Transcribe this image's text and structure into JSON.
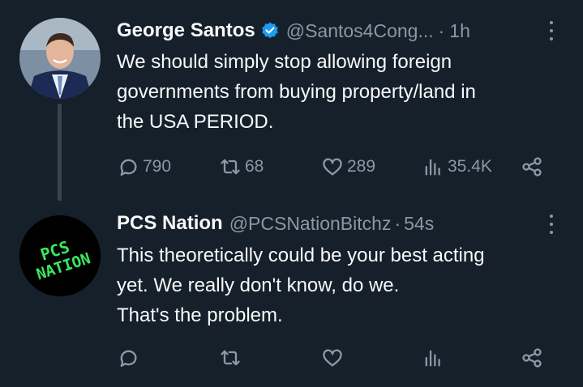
{
  "tweets": [
    {
      "name": "George Santos",
      "verified": true,
      "handle": "@Santos4Cong...",
      "time": "1h",
      "text": [
        "We should simply stop allowing foreign",
        "governments from buying property/land in",
        "the USA PERIOD."
      ],
      "replies": "790",
      "retweets": "68",
      "likes": "289",
      "views": "35.4K"
    },
    {
      "name": "PCS Nation",
      "handle": "@PCSNationBitchz",
      "time": "54s",
      "avatar_text": [
        "PCS",
        "NATION"
      ],
      "text": [
        "This theoretically could be your best acting",
        "yet. We really don't know, do we.",
        "That's the problem."
      ],
      "replies": "",
      "retweets": "",
      "likes": "",
      "views": ""
    }
  ],
  "separator": "·",
  "colors": {
    "background": "#15202b",
    "muted": "#8b98a5",
    "verified": "#1d9bf0",
    "pcs_green": "#39e75f"
  }
}
